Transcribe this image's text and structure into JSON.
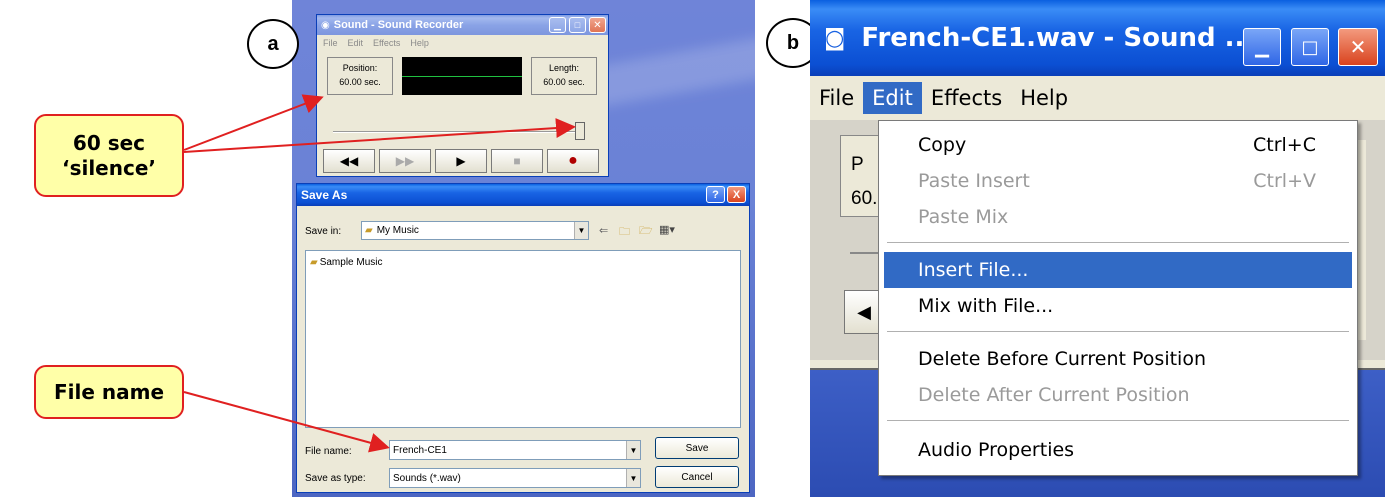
{
  "labels": {
    "a": "a",
    "b": "b"
  },
  "callouts": {
    "silence": "60 sec\n‘silence’",
    "filename": "File name"
  },
  "recorder": {
    "title": "Sound - Sound Recorder",
    "menu": [
      "File",
      "Edit",
      "Effects",
      "Help"
    ],
    "position_label": "Position:",
    "position_value": "60.00 sec.",
    "length_label": "Length:",
    "length_value": "60.00 sec.",
    "transport": [
      "◀◀",
      "▶▶",
      "▶",
      "■",
      "●"
    ]
  },
  "saveas": {
    "title": "Save As",
    "save_in_label": "Save in:",
    "save_in_value": "My Music",
    "items": [
      "Sample Music"
    ],
    "file_name_label": "File name:",
    "file_name_value": "French-CE1",
    "save_type_label": "Save as type:",
    "save_type_value": "Sounds (*.wav)",
    "save_button": "Save",
    "cancel_button": "Cancel",
    "help_button": "?",
    "close_button": "X"
  },
  "right": {
    "title": "French-CE1.wav - Sound ...",
    "menu": [
      "File",
      "Edit",
      "Effects",
      "Help"
    ],
    "behind_label_1": "P",
    "behind_label_2": "60.",
    "edit_menu": [
      {
        "label": "Copy",
        "shortcut": "Ctrl+C",
        "state": "enabled"
      },
      {
        "label": "Paste Insert",
        "shortcut": "Ctrl+V",
        "state": "disabled"
      },
      {
        "label": "Paste Mix",
        "shortcut": "",
        "state": "disabled"
      },
      {
        "label": "Insert File...",
        "shortcut": "",
        "state": "highlighted"
      },
      {
        "label": "Mix with File...",
        "shortcut": "",
        "state": "enabled"
      },
      {
        "label": "Delete Before Current Position",
        "shortcut": "",
        "state": "enabled"
      },
      {
        "label": "Delete After Current Position",
        "shortcut": "",
        "state": "disabled"
      },
      {
        "label": "Audio Properties",
        "shortcut": "",
        "state": "enabled"
      }
    ]
  },
  "colors": {
    "callout_fill": "#ffffa8",
    "callout_border": "#e02020",
    "arrow": "#e02020",
    "xp_title": "#0b4fd3",
    "menu_highlight": "#316ac5"
  }
}
